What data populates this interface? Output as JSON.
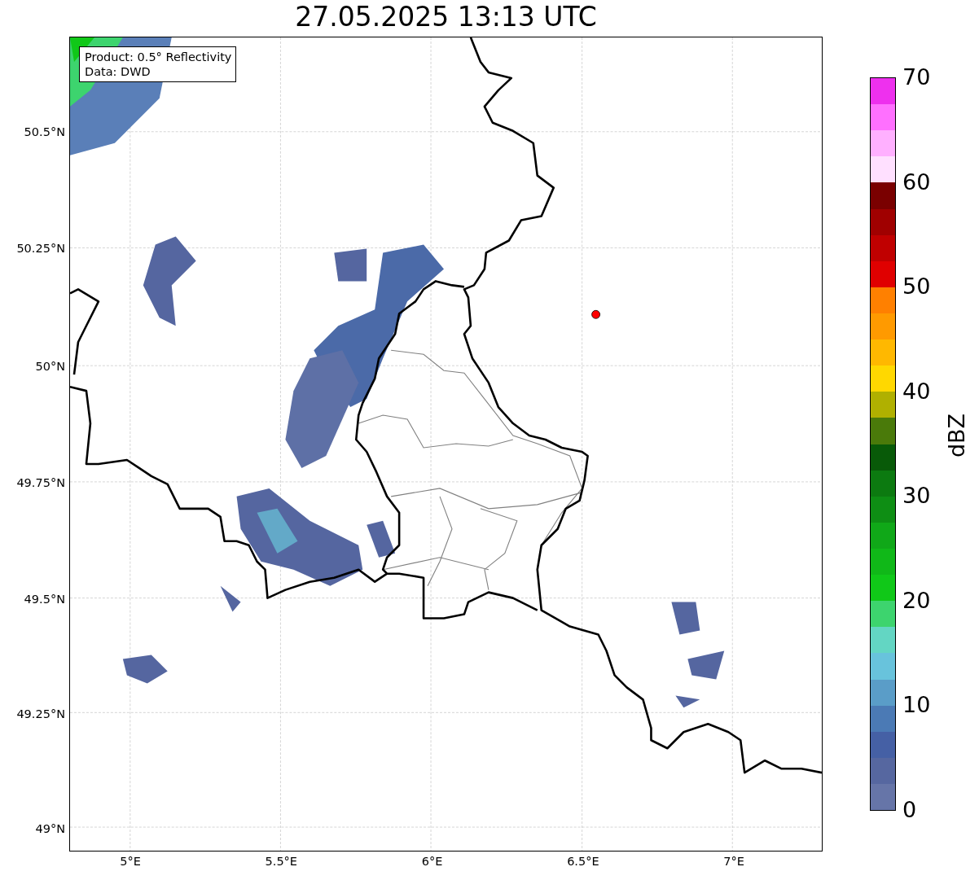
{
  "title": "27.05.2025 13:13 UTC",
  "map": {
    "legend": [
      "Product: 0.5° Reflectivity",
      "Data: DWD"
    ],
    "yticks": [
      "50.5°N",
      "50.25°N",
      "50°N",
      "49.75°N",
      "49.5°N",
      "49.25°N",
      "49°N"
    ],
    "xticks": [
      "5°E",
      "5.5°E",
      "6°E",
      "6.5°E",
      "7°E"
    ]
  },
  "colorbar": {
    "label": "dBZ",
    "ticks": [
      "70",
      "60",
      "50",
      "40",
      "30",
      "20",
      "10",
      "0"
    ],
    "segments": [
      {
        "color": "#ee30ee"
      },
      {
        "color": "#ff70ff"
      },
      {
        "color": "#ffb0ff"
      },
      {
        "color": "#ffe0ff"
      },
      {
        "color": "#7a0000"
      },
      {
        "color": "#a00000"
      },
      {
        "color": "#c00000"
      },
      {
        "color": "#e00000"
      },
      {
        "color": "#ff8000"
      },
      {
        "color": "#ff9a00"
      },
      {
        "color": "#ffb800"
      },
      {
        "color": "#ffd800"
      },
      {
        "color": "#b0b000"
      },
      {
        "color": "#4a7a0a"
      },
      {
        "color": "#085a08"
      },
      {
        "color": "#0c7a10"
      },
      {
        "color": "#0e8e14"
      },
      {
        "color": "#10a818"
      },
      {
        "color": "#10b818"
      },
      {
        "color": "#10c818"
      },
      {
        "color": "#3dd46e"
      },
      {
        "color": "#63d6c3"
      },
      {
        "color": "#68c3dc"
      },
      {
        "color": "#5a9dc8"
      },
      {
        "color": "#4b7ab5"
      },
      {
        "color": "#4560a5"
      },
      {
        "color": "#5667a0"
      },
      {
        "color": "#6675a8"
      }
    ]
  }
}
